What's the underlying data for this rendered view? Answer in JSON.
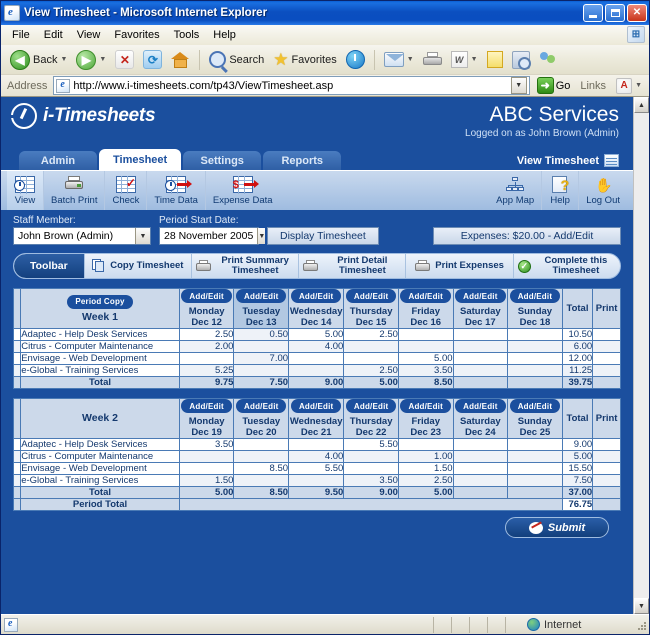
{
  "browser": {
    "title": "View Timesheet - Microsoft Internet Explorer",
    "window_controls": {
      "minimize": "_",
      "maximize": "□",
      "close": "✕"
    },
    "menu": [
      "File",
      "Edit",
      "View",
      "Favorites",
      "Tools",
      "Help"
    ],
    "toolbar": {
      "back": "Back",
      "search": "Search",
      "favorites": "Favorites"
    },
    "address": {
      "label": "Address",
      "url": "http://www.i-timesheets.com/tp43/ViewTimesheet.asp",
      "go": "Go",
      "links": "Links"
    },
    "status": {
      "zone": "Internet"
    }
  },
  "app": {
    "brand": "i-Timesheets",
    "company": "ABC Services",
    "logged_on": "Logged on as John Brown (Admin)",
    "tabs": [
      {
        "label": "Admin",
        "active": false
      },
      {
        "label": "Timesheet",
        "active": true
      },
      {
        "label": "Settings",
        "active": false
      },
      {
        "label": "Reports",
        "active": false
      }
    ],
    "page_indicator": "View Timesheet",
    "ribbon_left": [
      {
        "label": "View",
        "icon": "grid-clock-icon",
        "selected": true
      },
      {
        "label": "Batch Print",
        "icon": "printer-icon",
        "selected": false
      },
      {
        "label": "Check",
        "icon": "grid-check-icon",
        "selected": false
      },
      {
        "label": "Time Data",
        "icon": "grid-clock-arrow-icon",
        "selected": false
      },
      {
        "label": "Expense Data",
        "icon": "grid-dollar-arrow-icon",
        "selected": false
      }
    ],
    "ribbon_right": [
      {
        "label": "App Map",
        "icon": "sitemap-icon"
      },
      {
        "label": "Help",
        "icon": "help-icon"
      },
      {
        "label": "Log Out",
        "icon": "hand-wave-icon"
      }
    ]
  },
  "filters": {
    "staff_label": "Staff Member:",
    "staff_value": "John Brown (Admin)",
    "period_label": "Period Start Date:",
    "period_value": "28 November 2005",
    "display_button": "Display Timesheet",
    "expenses_button": "Expenses: $20.00 - Add/Edit"
  },
  "toolbar_strip": {
    "label": "Toolbar",
    "items": [
      {
        "label": "Copy Timesheet",
        "icon": "copy-icon"
      },
      {
        "label": "Print Summary Timesheet",
        "icon": "printer-icon"
      },
      {
        "label": "Print Detail Timesheet",
        "icon": "printer-icon"
      },
      {
        "label": "Print Expenses",
        "icon": "printer-icon"
      },
      {
        "label": "Complete this Timesheet",
        "icon": "green-check-icon"
      }
    ]
  },
  "common": {
    "add_edit": "Add/Edit",
    "period_copy": "Period Copy",
    "total_col": "Total",
    "print_col": "Print",
    "total_row": "Total",
    "period_total_row": "Period Total"
  },
  "week1": {
    "title": "Week 1",
    "days": [
      {
        "name": "Monday",
        "date": "Dec 12"
      },
      {
        "name": "Tuesday",
        "date": "Dec 13"
      },
      {
        "name": "Wednesday",
        "date": "Dec 14"
      },
      {
        "name": "Thursday",
        "date": "Dec 15"
      },
      {
        "name": "Friday",
        "date": "Dec 16"
      },
      {
        "name": "Saturday",
        "date": "Dec 17"
      },
      {
        "name": "Sunday",
        "date": "Dec 18"
      }
    ],
    "highlight_day_index": 1,
    "rows": [
      {
        "task": "Adaptec - Help Desk Services",
        "values": [
          "2.50",
          "0.50",
          "5.00",
          "2.50",
          "",
          "",
          ""
        ],
        "total": "10.50"
      },
      {
        "task": "Citrus - Computer Maintenance",
        "values": [
          "2.00",
          "",
          "4.00",
          "",
          "",
          "",
          ""
        ],
        "total": "6.00"
      },
      {
        "task": "Envisage - Web Development",
        "values": [
          "",
          "7.00",
          "",
          "",
          "5.00",
          "",
          ""
        ],
        "total": "12.00"
      },
      {
        "task": "e-Global - Training Services",
        "values": [
          "5.25",
          "",
          "",
          "2.50",
          "3.50",
          "",
          ""
        ],
        "total": "11.25"
      }
    ],
    "totals": [
      "9.75",
      "7.50",
      "9.00",
      "5.00",
      "8.50",
      "",
      ""
    ],
    "grand_total": "39.75"
  },
  "week2": {
    "title": "Week 2",
    "days": [
      {
        "name": "Monday",
        "date": "Dec 19"
      },
      {
        "name": "Tuesday",
        "date": "Dec 20"
      },
      {
        "name": "Wednesday",
        "date": "Dec 21"
      },
      {
        "name": "Thursday",
        "date": "Dec 22"
      },
      {
        "name": "Friday",
        "date": "Dec 23"
      },
      {
        "name": "Saturday",
        "date": "Dec 24"
      },
      {
        "name": "Sunday",
        "date": "Dec 25"
      }
    ],
    "highlight_day_index": -1,
    "rows": [
      {
        "task": "Adaptec - Help Desk Services",
        "values": [
          "3.50",
          "",
          "",
          "5.50",
          "",
          "",
          ""
        ],
        "total": "9.00"
      },
      {
        "task": "Citrus - Computer Maintenance",
        "values": [
          "",
          "",
          "4.00",
          "",
          "1.00",
          "",
          ""
        ],
        "total": "5.00"
      },
      {
        "task": "Envisage - Web Development",
        "values": [
          "",
          "8.50",
          "5.50",
          "",
          "1.50",
          "",
          ""
        ],
        "total": "15.50"
      },
      {
        "task": "e-Global - Training Services",
        "values": [
          "1.50",
          "",
          "",
          "3.50",
          "2.50",
          "",
          ""
        ],
        "total": "7.50"
      }
    ],
    "totals": [
      "5.00",
      "8.50",
      "9.50",
      "9.00",
      "5.00",
      "",
      ""
    ],
    "grand_total": "37.00",
    "period_total": "76.75"
  },
  "submit": {
    "label": "Submit"
  },
  "colors": {
    "app_blue": "#1b4f9e",
    "header_cell": "#ccd9ea",
    "stripe": "#eef2f8",
    "text_blue": "#14396e",
    "title_bar": "#0b4fc0"
  }
}
